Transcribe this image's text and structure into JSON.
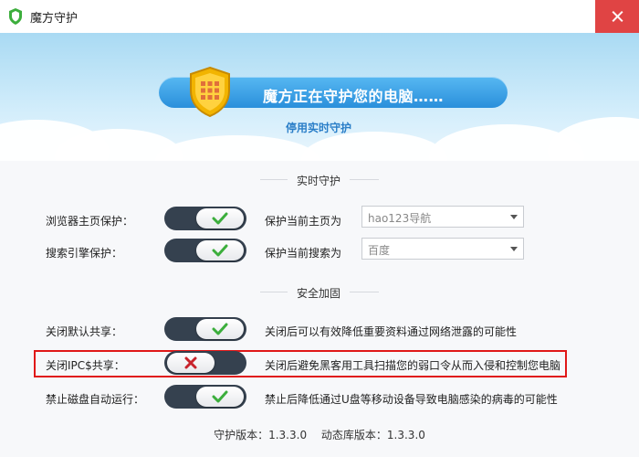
{
  "window": {
    "title": "魔方守护"
  },
  "banner": {
    "status_text": "魔方正在守护您的电脑……",
    "stop_link": "停用实时守护"
  },
  "realtime": {
    "section_title": "实时守护",
    "rows": [
      {
        "label": "浏览器主页保护：",
        "enabled": true,
        "desc": "保护当前主页为",
        "select_value": "hao123导航"
      },
      {
        "label": "搜索引擎保护：",
        "enabled": true,
        "desc": "保护当前搜索为",
        "select_value": "百度"
      }
    ]
  },
  "security": {
    "section_title": "安全加固",
    "rows": [
      {
        "label": "关闭默认共享：",
        "enabled": true,
        "desc": "关闭后可以有效降低重要资料通过网络泄露的可能性"
      },
      {
        "label": "关闭IPC$共享：",
        "enabled": false,
        "desc": "关闭后避免黑客用工具扫描您的弱口令从而入侵和控制您电脑"
      },
      {
        "label": "禁止磁盘自动运行：",
        "enabled": true,
        "desc": "禁止后降低通过U盘等移动设备导致电脑感染的病毒的可能性"
      }
    ]
  },
  "footer": {
    "guard_version": "守护版本：1.3.3.0",
    "db_version": "动态库版本：1.3.3.0"
  },
  "colors": {
    "accent": "#2a8fdb",
    "toggle_track": "#35414f",
    "check_on": "#3cae3c",
    "cross_off": "#c8232c",
    "close": "#e04444",
    "highlight_box": "#e01818"
  },
  "icons": {
    "app": "shield-icon",
    "banner": "shield-grid-icon",
    "toggle_on": "check-icon",
    "toggle_off": "cross-icon"
  }
}
